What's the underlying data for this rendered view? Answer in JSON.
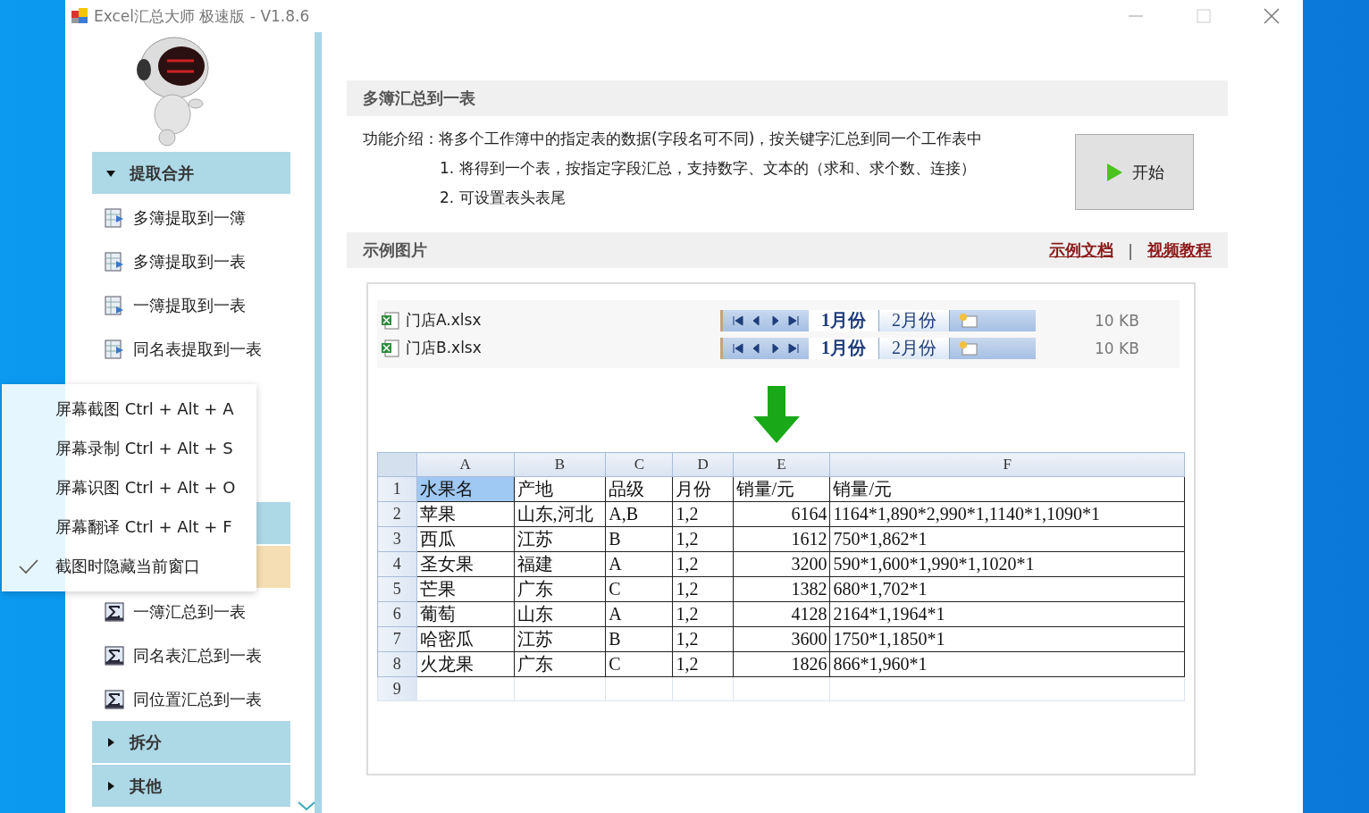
{
  "window": {
    "title": "Excel汇总大师 极速版 - V1.8.6"
  },
  "sidebar": {
    "sections": [
      {
        "label": "提取合并",
        "expanded": true,
        "kind": "sheet",
        "items": [
          {
            "label": "多簿提取到一簿",
            "selected": false
          },
          {
            "label": "多簿提取到一表",
            "selected": false
          },
          {
            "label": "一簿提取到一表",
            "selected": false
          },
          {
            "label": "同名表提取到一表",
            "selected": false
          },
          {
            "selected": false
          },
          {
            "selected": false
          },
          {
            "selected": false
          }
        ]
      },
      {
        "expanded": true,
        "kind": "sigma",
        "items": [
          {
            "selected": true
          },
          {
            "label": "一簿汇总到一表",
            "selected": false
          },
          {
            "label": "同名表汇总到一表",
            "selected": false
          },
          {
            "label": "同位置汇总到一表",
            "selected": false
          }
        ]
      },
      {
        "label": "拆分",
        "expanded": false
      },
      {
        "label": "其他",
        "expanded": false
      }
    ]
  },
  "context_menu": {
    "items": [
      {
        "label": "屏幕截图 Ctrl + Alt + A",
        "checked": false
      },
      {
        "label": "屏幕录制 Ctrl + Alt + S",
        "checked": false
      },
      {
        "label": "屏幕识图 Ctrl + Alt + O",
        "checked": false
      },
      {
        "label": "屏幕翻译 Ctrl + Alt + F",
        "checked": false
      },
      {
        "label": "截图时隐藏当前窗口",
        "checked": true
      }
    ]
  },
  "function_panel": {
    "title": "多簿汇总到一表",
    "intro": "功能介绍：将多个工作簿中的指定表的数据(字段名可不同)，按关键字汇总到同一个工作表中",
    "points": [
      "1. 将得到一个表，按指定字段汇总，支持数字、文本的（求和、求个数、连接）",
      "2. 可设置表头表尾"
    ],
    "start_button": "开始"
  },
  "example": {
    "title": "示例图片",
    "links": [
      "示例文档",
      "视频教程"
    ],
    "separator": "|",
    "files": [
      {
        "name": "门店A.xlsx",
        "size": "10 KB",
        "tabs": [
          {
            "label": "1月份",
            "selected": true
          },
          {
            "label": "2月份",
            "selected": false
          }
        ]
      },
      {
        "name": "门店B.xlsx",
        "size": "10 KB",
        "tabs": [
          {
            "label": "1月份",
            "selected": true
          },
          {
            "label": "2月份",
            "selected": false
          }
        ]
      }
    ],
    "sheet": {
      "columns": [
        {
          "name": "A",
          "kind": "text"
        },
        {
          "name": "B",
          "kind": "text"
        },
        {
          "name": "C",
          "kind": "text"
        },
        {
          "name": "D",
          "kind": "text"
        },
        {
          "name": "E",
          "kind": "number"
        },
        {
          "name": "F",
          "kind": "text"
        }
      ],
      "rows": [
        {
          "number": "1",
          "kind": "header",
          "cells": [
            {
              "text": "水果名",
              "selected": true
            },
            {
              "text": "产地",
              "selected": false
            },
            {
              "text": "品级",
              "selected": false
            },
            {
              "text": "月份",
              "selected": false
            },
            {
              "text": "销量/元",
              "selected": false
            },
            {
              "text": "销量/元",
              "selected": false
            }
          ]
        },
        {
          "number": "2",
          "kind": "data",
          "cells": [
            {
              "text": "苹果",
              "selected": false
            },
            {
              "text": "山东,河北",
              "selected": false
            },
            {
              "text": "A,B",
              "selected": false
            },
            {
              "text": "1,2",
              "selected": false
            },
            {
              "text": "6164",
              "selected": false
            },
            {
              "text": "1164*1,890*2,990*1,1140*1,1090*1",
              "selected": false
            }
          ]
        },
        {
          "number": "3",
          "kind": "data",
          "cells": [
            {
              "text": "西瓜",
              "selected": false
            },
            {
              "text": "江苏",
              "selected": false
            },
            {
              "text": "B",
              "selected": false
            },
            {
              "text": "1,2",
              "selected": false
            },
            {
              "text": "1612",
              "selected": false
            },
            {
              "text": "750*1,862*1",
              "selected": false
            }
          ]
        },
        {
          "number": "4",
          "kind": "data",
          "cells": [
            {
              "text": "圣女果",
              "selected": false
            },
            {
              "text": "福建",
              "selected": false
            },
            {
              "text": "A",
              "selected": false
            },
            {
              "text": "1,2",
              "selected": false
            },
            {
              "text": "3200",
              "selected": false
            },
            {
              "text": "590*1,600*1,990*1,1020*1",
              "selected": false
            }
          ]
        },
        {
          "number": "5",
          "kind": "data",
          "cells": [
            {
              "text": "芒果",
              "selected": false
            },
            {
              "text": "广东",
              "selected": false
            },
            {
              "text": "C",
              "selected": false
            },
            {
              "text": "1,2",
              "selected": false
            },
            {
              "text": "1382",
              "selected": false
            },
            {
              "text": "680*1,702*1",
              "selected": false
            }
          ]
        },
        {
          "number": "6",
          "kind": "data",
          "cells": [
            {
              "text": "葡萄",
              "selected": false
            },
            {
              "text": "山东",
              "selected": false
            },
            {
              "text": "A",
              "selected": false
            },
            {
              "text": "1,2",
              "selected": false
            },
            {
              "text": "4128",
              "selected": false
            },
            {
              "text": "2164*1,1964*1",
              "selected": false
            }
          ]
        },
        {
          "number": "7",
          "kind": "data",
          "cells": [
            {
              "text": "哈密瓜",
              "selected": false
            },
            {
              "text": "江苏",
              "selected": false
            },
            {
              "text": "B",
              "selected": false
            },
            {
              "text": "1,2",
              "selected": false
            },
            {
              "text": "3600",
              "selected": false
            },
            {
              "text": "1750*1,1850*1",
              "selected": false
            }
          ]
        },
        {
          "number": "8",
          "kind": "data",
          "cells": [
            {
              "text": "火龙果",
              "selected": false
            },
            {
              "text": "广东",
              "selected": false
            },
            {
              "text": "C",
              "selected": false
            },
            {
              "text": "1,2",
              "selected": false
            },
            {
              "text": "1826",
              "selected": false
            },
            {
              "text": "866*1,960*1",
              "selected": false
            }
          ]
        },
        {
          "number": "9",
          "kind": "empty"
        }
      ]
    }
  }
}
